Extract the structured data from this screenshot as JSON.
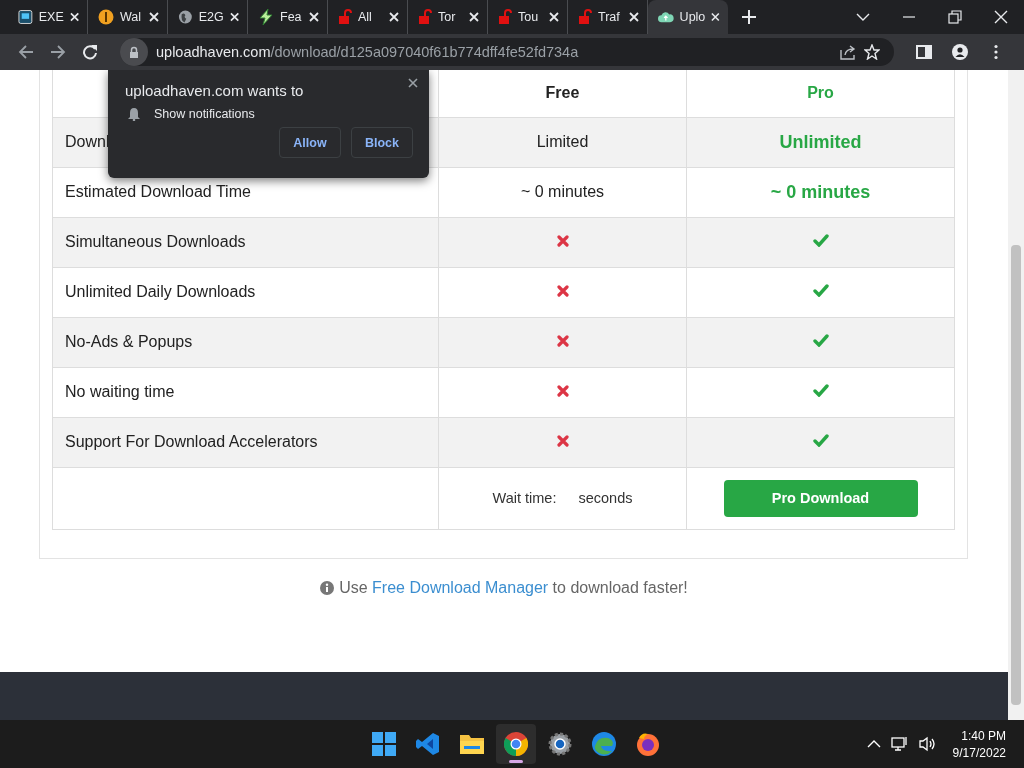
{
  "tabs": [
    {
      "kind": "monitor",
      "title": "EXE",
      "selected": false
    },
    {
      "kind": "bulb",
      "title": "Wal",
      "selected": false
    },
    {
      "kind": "globe",
      "title": "E2G",
      "selected": false
    },
    {
      "kind": "bolt",
      "title": "Fea",
      "selected": false
    },
    {
      "kind": "lock",
      "title": "All",
      "selected": false
    },
    {
      "kind": "lock",
      "title": "Tor",
      "selected": false
    },
    {
      "kind": "lock",
      "title": "Tou",
      "selected": false
    },
    {
      "kind": "lock",
      "title": "Traf",
      "selected": false
    },
    {
      "kind": "cloud",
      "title": "Uplo",
      "selected": true
    }
  ],
  "address": {
    "domain": "uploadhaven.com",
    "path": "/download/d125a097040f61b774dff4fe52fd734a"
  },
  "popup": {
    "title": "uploadhaven.com wants to",
    "permission": "Show notifications",
    "buttons": [
      "Allow",
      "Block"
    ]
  },
  "table": {
    "columns": [
      "Free",
      "Pro"
    ],
    "rows": [
      {
        "feature": "Downl",
        "free": {
          "kind": "text",
          "text": "Limited"
        },
        "pro": {
          "kind": "text",
          "text": "Unlimited"
        }
      },
      {
        "feature": "Estimated Download Time",
        "free": {
          "kind": "text",
          "text": "~ 0 minutes"
        },
        "pro": {
          "kind": "text",
          "text": "~ 0 minutes"
        }
      },
      {
        "feature": "Simultaneous Downloads",
        "free": {
          "kind": "cross"
        },
        "pro": {
          "kind": "check"
        }
      },
      {
        "feature": "Unlimited Daily Downloads",
        "free": {
          "kind": "cross"
        },
        "pro": {
          "kind": "check"
        }
      },
      {
        "feature": "No-Ads & Popups",
        "free": {
          "kind": "cross"
        },
        "pro": {
          "kind": "check"
        }
      },
      {
        "feature": "No waiting time",
        "free": {
          "kind": "cross"
        },
        "pro": {
          "kind": "check"
        }
      },
      {
        "feature": "Support For Download Accelerators",
        "free": {
          "kind": "cross"
        },
        "pro": {
          "kind": "check"
        }
      }
    ],
    "wait_label": "Wait time:",
    "wait_unit": "seconds",
    "pro_button": "Pro Download"
  },
  "tip": {
    "before": "Use ",
    "link": "Free Download Manager",
    "after": " to download faster!"
  },
  "taskbar": {
    "apps": [
      {
        "kind": "windows",
        "selected": false
      },
      {
        "kind": "code",
        "selected": false
      },
      {
        "kind": "folder",
        "selected": false
      },
      {
        "kind": "chrome",
        "selected": true
      },
      {
        "kind": "gear",
        "selected": false
      },
      {
        "kind": "edge",
        "selected": false
      },
      {
        "kind": "firefox",
        "selected": false
      }
    ],
    "time": "1:40 PM",
    "date": "9/17/2022"
  }
}
